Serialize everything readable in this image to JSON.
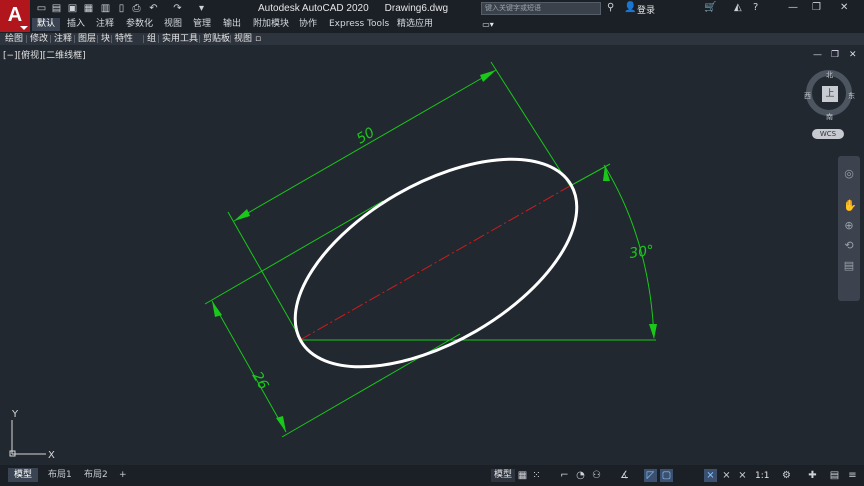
{
  "app": {
    "logo_letter": "A",
    "title": "Autodesk AutoCAD 2020",
    "drawing": "Drawing6.dwg"
  },
  "search": {
    "placeholder": "键入关键字或短语"
  },
  "account": {
    "login": "登录"
  },
  "ribbon_tabs": [
    "默认",
    "插入",
    "注释",
    "参数化",
    "视图",
    "管理",
    "输出",
    "附加模块",
    "协作",
    "Express Tools",
    "精选应用"
  ],
  "ribbon_active": "默认",
  "panels": [
    "绘图",
    "修改",
    "注释",
    "图层",
    "块",
    "特性",
    "组",
    "实用工具",
    "剪贴板",
    "视图"
  ],
  "viewport": {
    "label": "[−][俯视][二维线框]"
  },
  "drawing": {
    "dim_length": "50",
    "dim_width": "26",
    "dim_angle": "30°"
  },
  "viewcube": {
    "north": "北",
    "south": "南",
    "east": "东",
    "west": "西",
    "face": "上",
    "wcs": "WCS"
  },
  "ucs": {
    "x": "X",
    "y": "Y"
  },
  "layout_tabs": [
    "模型",
    "布局1",
    "布局2",
    "+"
  ],
  "status": {
    "model": "模型",
    "scale": "1:1"
  },
  "colors": {
    "geometry": "#ffffff",
    "dimension": "#19c819",
    "centerline": "#d01c1c",
    "background": "#212830"
  }
}
